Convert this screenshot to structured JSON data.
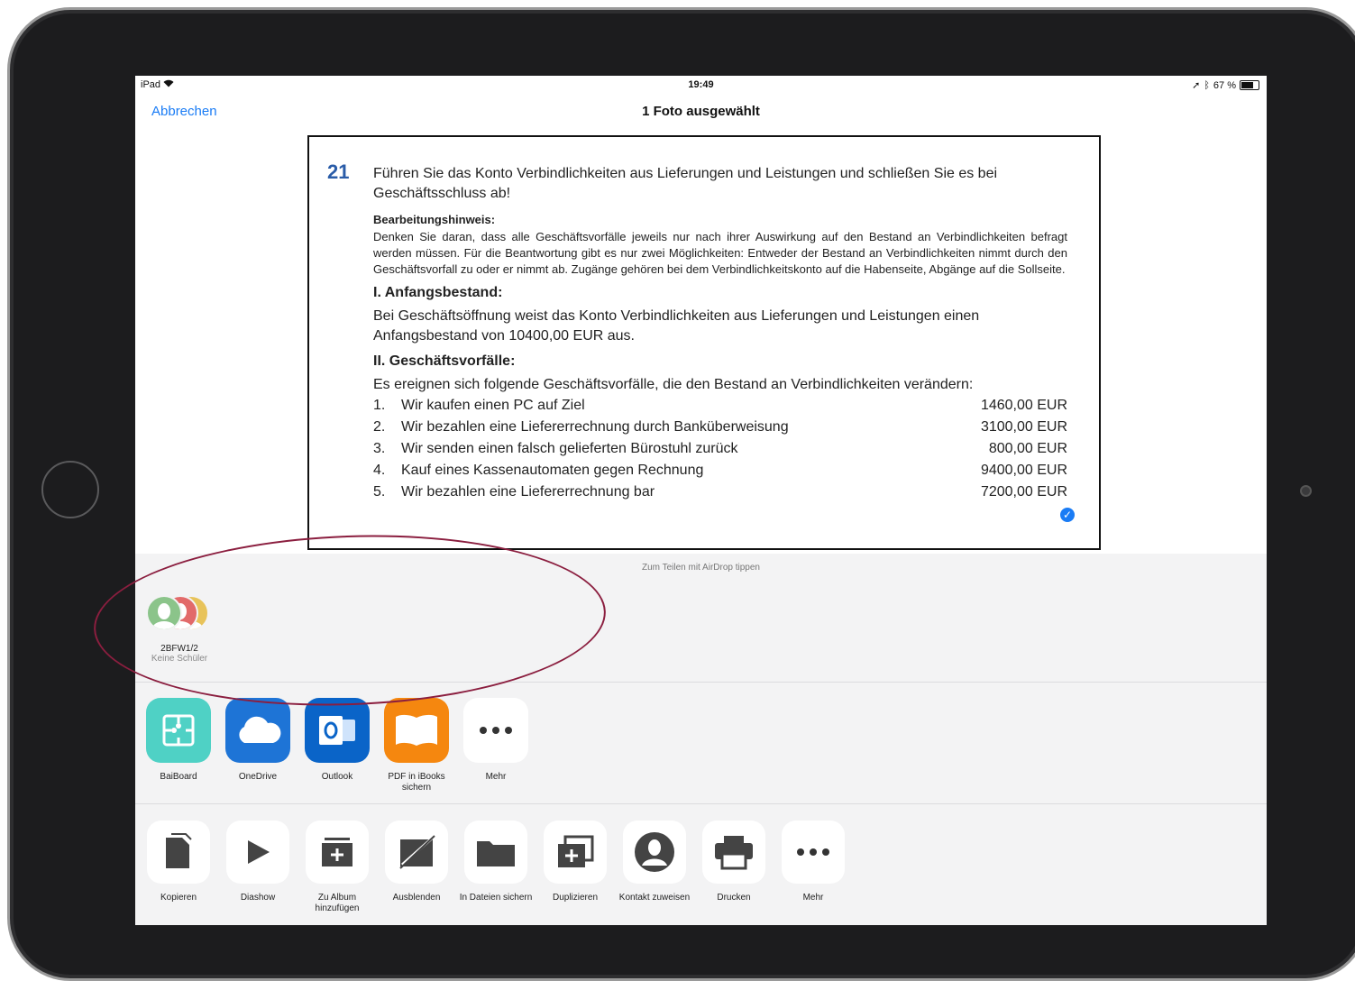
{
  "status_bar": {
    "device": "iPad",
    "time": "19:49",
    "battery": "67 %",
    "battery_level": 0.67
  },
  "nav": {
    "cancel_label": "Abbrechen",
    "title": "1 Foto ausgewählt"
  },
  "document": {
    "number": "21",
    "heading": "Führen Sie das Konto Verbindlichkeiten aus Lieferungen und Leistungen und schließen Sie es bei Geschäftsschluss ab!",
    "hint_title": "Bearbeitungshinweis:",
    "hint_text": "Denken Sie daran, dass alle Geschäftsvorfälle jeweils nur nach ihrer Auswirkung auf den Bestand an Verbind­lichkeiten befragt werden müssen. Für die Beantwortung gibt es nur zwei Möglichkeiten: Entweder der Bestand an Verbindlichkeiten nimmt durch den Geschäftsvorfall zu oder er nimmt ab. Zugänge gehören bei dem Verbindlichkeitskonto auf die Habenseite, Abgänge auf die Sollseite.",
    "section1_title": "I. Anfangsbestand:",
    "section1_text": "Bei Geschäftsöffnung weist das Konto Verbindlichkeiten aus Lieferungen und Leistungen einen Anfangsbestand von 10400,00 EUR aus.",
    "section2_title": "II. Geschäftsvorfälle:",
    "section2_intro": "Es ereignen sich folgende Geschäftsvorfälle, die den Bestand an Verbindlichkeiten verändern:",
    "transactions": [
      {
        "num": "1.",
        "label": "Wir kaufen einen PC auf Ziel",
        "amount": "1460,00 EUR"
      },
      {
        "num": "2.",
        "label": "Wir bezahlen eine Liefererrechnung durch Banküberweisung",
        "amount": "3100,00 EUR"
      },
      {
        "num": "3.",
        "label": "Wir senden einen falsch gelieferten Bürostuhl zurück",
        "amount": "800,00 EUR"
      },
      {
        "num": "4.",
        "label": "Kauf eines Kassenautomaten gegen Rechnung",
        "amount": "9400,00 EUR"
      },
      {
        "num": "5.",
        "label": "Wir bezahlen eine Liefererrechnung bar",
        "amount": "7200,00 EUR"
      }
    ]
  },
  "share_sheet": {
    "airdrop_hint": "Zum Teilen mit AirDrop tippen",
    "contact": {
      "name": "2BFW1/2",
      "subtitle": "Keine Schüler",
      "colors": [
        "#8bc48a",
        "#e26a6a",
        "#e8c35a"
      ]
    },
    "apps": [
      {
        "label": "BaiBoard",
        "icon": "puzzle-icon",
        "color": "#4fd1c5"
      },
      {
        "label": "OneDrive",
        "icon": "cloud-icon",
        "color": "#1e74d6"
      },
      {
        "label": "Outlook",
        "icon": "outlook-icon",
        "color": "#0a64c8"
      },
      {
        "label": "PDF in iBooks sichern",
        "icon": "book-icon",
        "color": "#f5870f"
      },
      {
        "label": "Mehr",
        "icon": "more-icon",
        "color": "#ffffff"
      }
    ],
    "actions": [
      {
        "label": "Kopieren",
        "icon": "copy-icon"
      },
      {
        "label": "Diashow",
        "icon": "play-icon"
      },
      {
        "label": "Zu Album hinzufügen",
        "icon": "add-album-icon"
      },
      {
        "label": "Ausblenden",
        "icon": "hide-icon"
      },
      {
        "label": "In Dateien sichern",
        "icon": "folder-icon"
      },
      {
        "label": "Duplizieren",
        "icon": "duplicate-icon"
      },
      {
        "label": "Kontakt zuweisen",
        "icon": "contact-icon"
      },
      {
        "label": "Drucken",
        "icon": "print-icon"
      },
      {
        "label": "Mehr",
        "icon": "more-icon"
      }
    ]
  },
  "annotation": {
    "color": "#8b1e3f"
  }
}
